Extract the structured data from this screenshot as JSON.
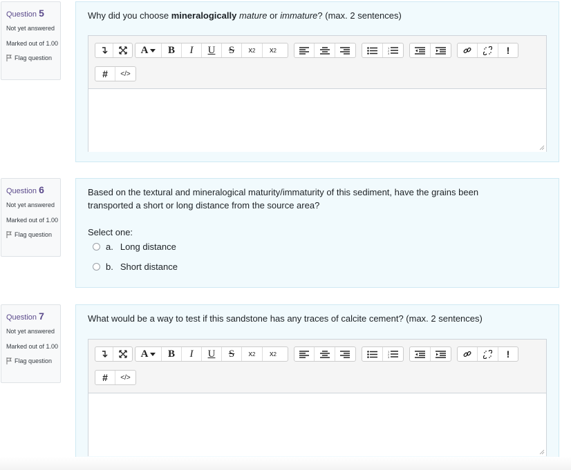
{
  "q5": {
    "label": "Question",
    "number": "5",
    "state": "Not yet answered",
    "grade": "Marked out of 1.00",
    "flag": "Flag question",
    "text_pre": "Why did you choose ",
    "text_bold": "mineralogically",
    "text_mid1": " ",
    "text_it1": "mature",
    "text_mid2": " or ",
    "text_it2": "immature",
    "text_post": "? (max. 2 sentences)"
  },
  "q6": {
    "label": "Question",
    "number": "6",
    "state": "Not yet answered",
    "grade": "Marked out of 1.00",
    "flag": "Flag question",
    "text_line1": "Based on the textural and mineralogical maturity/immaturity of this sediment, have the grains been",
    "text_line2": "transported a short or long distance from the source area?",
    "prompt": "Select one:",
    "options": [
      {
        "letter": "a.",
        "label": "Long distance"
      },
      {
        "letter": "b.",
        "label": "Short distance"
      }
    ]
  },
  "q7": {
    "label": "Question",
    "number": "7",
    "state": "Not yet answered",
    "grade": "Marked out of 1.00",
    "flag": "Flag question",
    "text": "What would be a way to test if this sandstone has any traces of calcite cement? (max. 2 sentences)"
  },
  "toolbar": {
    "font_color": "A",
    "bold": "B",
    "italic": "I",
    "underline": "U",
    "strike": "S",
    "subscript": "x",
    "subscript_sub": "2",
    "superscript": "x",
    "superscript_sup": "2",
    "important": "!",
    "hash": "#",
    "html": "</>"
  },
  "colors": {
    "accent": "#5b4a8b",
    "content_bg": "#f1fafd",
    "content_border": "#cfe9f3"
  }
}
